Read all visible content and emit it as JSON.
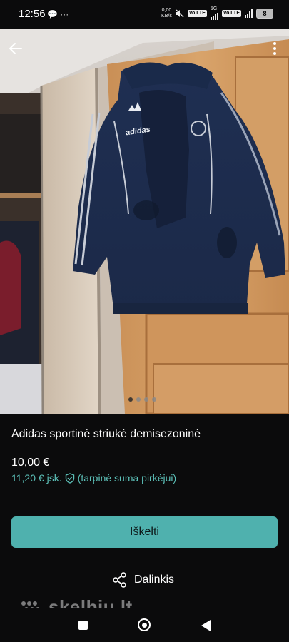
{
  "status_bar": {
    "time": "12:56",
    "left_icons": "💬 ···",
    "net_speed_top": "0,00",
    "net_speed_bottom": "KB/s",
    "volte_1": "Vo LTE",
    "net_type": "5G",
    "volte_2": "Vo LTE",
    "battery": "8"
  },
  "photo": {
    "image_count": 4,
    "active_index": 0,
    "logo_text": "adidas"
  },
  "listing": {
    "title": "Adidas sportinė striukė demisezoninė",
    "price": "10,00 €",
    "price_buyer": "11,20 €",
    "price_buyer_suffix": "jsk.",
    "price_buyer_note": "(tarpinė suma pirkėjui)"
  },
  "actions": {
    "cta_label": "Iškelti",
    "share_label": "Dalinkis"
  },
  "watermark": {
    "text": "skelbiu.lt"
  },
  "colors": {
    "accent": "#4fb1ae",
    "accent_text": "#5cc0b8",
    "background": "#0b0b0c"
  }
}
